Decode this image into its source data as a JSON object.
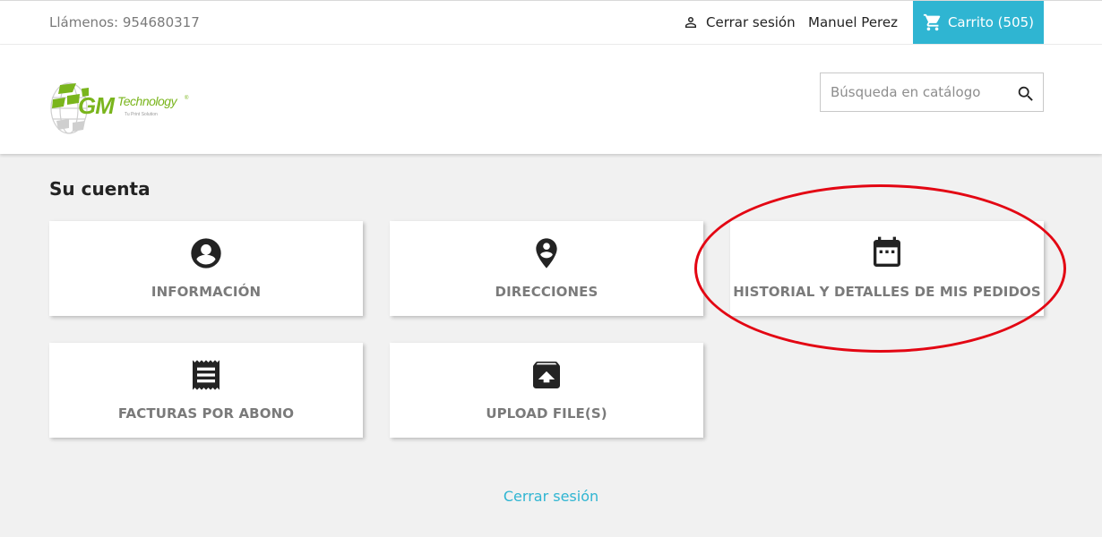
{
  "topbar": {
    "phone": "Llámenos: 954680317",
    "logout_label": "Cerrar sesión",
    "username": "Manuel Perez",
    "cart_label": "Carrito (505)"
  },
  "header": {
    "logo_text": "GM",
    "logo_subtext": "Technology",
    "logo_tagline": "Tu Print Solution",
    "search_placeholder": "Búsqueda en catálogo"
  },
  "account": {
    "title": "Su cuenta",
    "tiles": [
      {
        "label": "INFORMACIÓN",
        "icon": "account-circle-icon"
      },
      {
        "label": "DIRECCIONES",
        "icon": "location-pin-icon"
      },
      {
        "label": "HISTORIAL Y DETALLES DE MIS PEDIDOS",
        "icon": "calendar-icon"
      },
      {
        "label": "FACTURAS POR ABONO",
        "icon": "receipt-icon"
      },
      {
        "label": "UPLOAD FILE(S)",
        "icon": "upload-box-icon"
      }
    ],
    "logout_link": "Cerrar sesión"
  },
  "colors": {
    "accent": "#2fb5d2",
    "annotation": "#e30613",
    "logo_green": "#7ab51d"
  }
}
